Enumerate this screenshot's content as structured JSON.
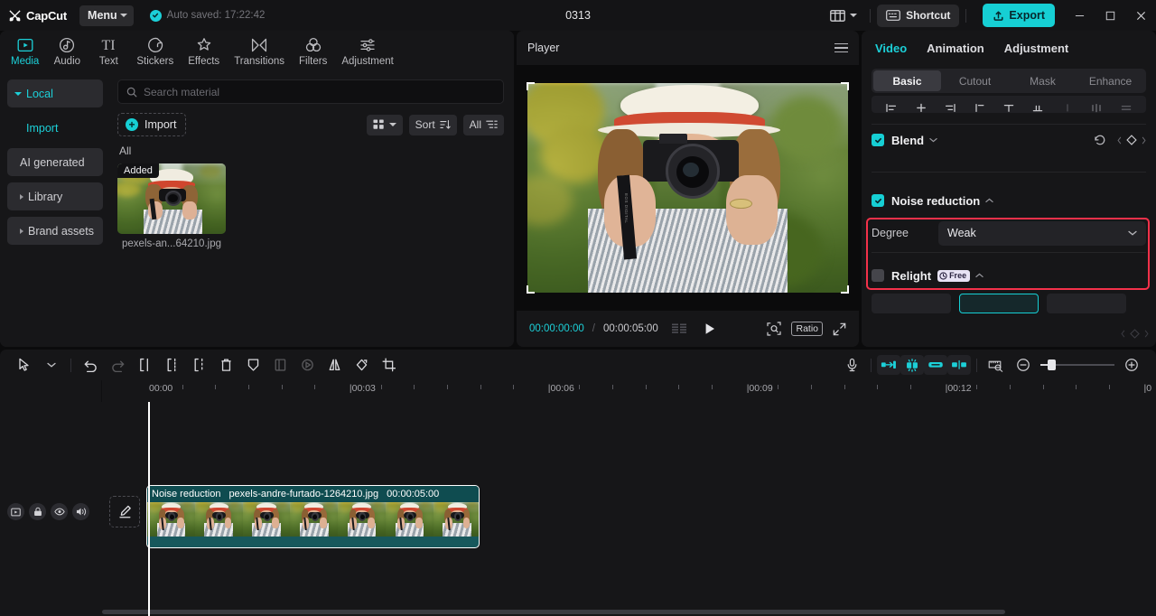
{
  "titlebar": {
    "app_name": "CapCut",
    "menu_label": "Menu",
    "autosave_text": "Auto saved: 17:22:42",
    "project_title": "0313",
    "shortcut_label": "Shortcut",
    "export_label": "Export",
    "icons": {
      "logo": "capcut-logo-icon",
      "layout": "layout-icon",
      "keyboard": "keyboard-icon",
      "upload": "upload-icon",
      "minimize": "minimize-icon",
      "maximize": "maximize-icon",
      "close": "close-icon"
    }
  },
  "media_tabs": [
    {
      "label": "Media",
      "icon": "media-icon",
      "active": true
    },
    {
      "label": "Audio",
      "icon": "audio-icon",
      "active": false
    },
    {
      "label": "Text",
      "icon": "text-icon",
      "active": false
    },
    {
      "label": "Stickers",
      "icon": "stickers-icon",
      "active": false
    },
    {
      "label": "Effects",
      "icon": "effects-icon",
      "active": false
    },
    {
      "label": "Transitions",
      "icon": "transitions-icon",
      "active": false
    },
    {
      "label": "Filters",
      "icon": "filters-icon",
      "active": false
    },
    {
      "label": "Adjustment",
      "icon": "adjustment-icon",
      "active": false
    }
  ],
  "media_sidebar": [
    {
      "label": "Local",
      "state": "selected-open"
    },
    {
      "label": "Import",
      "state": "sub-active"
    },
    {
      "label": "AI generated",
      "state": "pill"
    },
    {
      "label": "Library",
      "state": "collapsed"
    },
    {
      "label": "Brand assets",
      "state": "collapsed"
    }
  ],
  "media_toolbar": {
    "search_placeholder": "Search material",
    "search_value": "",
    "import_label": "Import",
    "view_label": "",
    "sort_label": "Sort",
    "filter_label": "All",
    "section_label": "All"
  },
  "media_items": [
    {
      "name": "pexels-an...64210.jpg",
      "badge": "Added"
    }
  ],
  "player": {
    "title": "Player",
    "current_time": "00:00:00:00",
    "separator": "/",
    "total_time": "00:00:05:00",
    "ratio_label": "Ratio",
    "icons": {
      "menu": "hamburger-icon",
      "frames": "frames-icon",
      "play": "play-icon",
      "detect": "detect-icon",
      "fullscreen": "fullscreen-icon"
    }
  },
  "attributes": {
    "tabs": [
      {
        "label": "Video",
        "active": true
      },
      {
        "label": "Animation",
        "active": false
      },
      {
        "label": "Adjustment",
        "active": false
      }
    ],
    "segments": [
      {
        "label": "Basic",
        "active": true
      },
      {
        "label": "Cutout",
        "active": false
      },
      {
        "label": "Mask",
        "active": false
      },
      {
        "label": "Enhance",
        "active": false
      }
    ],
    "properties": [
      {
        "name": "Blend",
        "checked": true,
        "expanded": false
      },
      {
        "name": "Noise reduction",
        "checked": true,
        "expanded": true,
        "highlighted": true
      },
      {
        "name": "Relight",
        "checked": false,
        "expanded": true,
        "badge": "Free"
      }
    ],
    "noise_reduction": {
      "degree_label": "Degree",
      "degree_value": "Weak"
    },
    "highlight_color": "#f4314a"
  },
  "timeline_toolbar": {
    "left_icons": [
      "select-icon",
      "chevron-down-icon",
      "undo-icon",
      "redo-icon",
      "split-icon",
      "trim-left-icon",
      "trim-right-icon",
      "delete-icon",
      "freeze-icon",
      "mirror-panel-icon",
      "reverse-icon",
      "flip-icon",
      "rotate-icon",
      "crop-icon"
    ],
    "right_icons": [
      "microphone-icon",
      "auto-stick-left-icon",
      "magnet-icon",
      "link-icon",
      "align-icon",
      "preview-scale-icon",
      "zoom-out-icon",
      "zoom-in-icon"
    ]
  },
  "timeline": {
    "ruler_labels": [
      "00:00",
      "00:03",
      "00:06",
      "00:09",
      "00:12",
      "0"
    ],
    "playhead_time": "00:00",
    "track_controls": [
      "monitor-icon",
      "lock-icon",
      "eye-icon",
      "volume-icon"
    ],
    "edit_icon": "pen-edit-icon",
    "clip": {
      "tag": "Noise reduction",
      "name": "pexels-andre-furtado-1264210.jpg",
      "duration": "00:00:05:00"
    }
  },
  "colors": {
    "accent": "#1cd0d8",
    "export": "#16cfd4",
    "clip": "#17585c",
    "highlight": "#f4314a"
  }
}
